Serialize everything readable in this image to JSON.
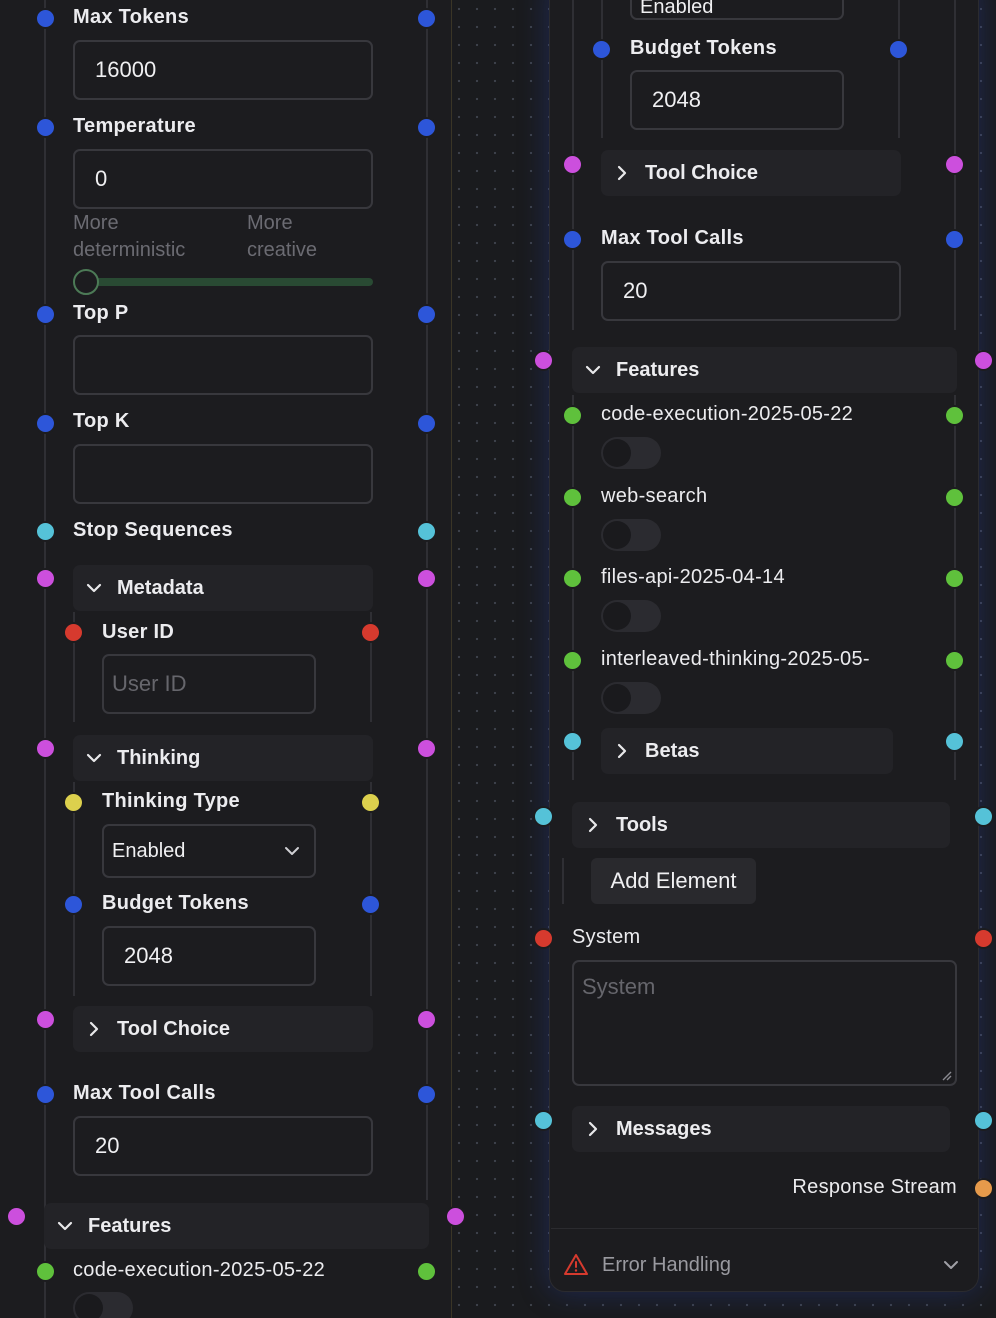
{
  "left": {
    "max_tokens": {
      "label": "Max Tokens",
      "value": "16000"
    },
    "temperature": {
      "label": "Temperature",
      "value": "0",
      "hint_low": "More deterministic",
      "hint_high": "More creative",
      "level": 0
    },
    "top_p": {
      "label": "Top P",
      "value": ""
    },
    "top_k": {
      "label": "Top K",
      "value": ""
    },
    "stop_sequences": {
      "label": "Stop Sequences"
    },
    "metadata": {
      "title": "Metadata",
      "user_id": {
        "label": "User ID",
        "placeholder": "User ID"
      }
    },
    "thinking": {
      "title": "Thinking",
      "type": {
        "label": "Thinking Type",
        "value": "Enabled"
      },
      "budget": {
        "label": "Budget Tokens",
        "value": "2048"
      }
    },
    "tool_choice": {
      "title": "Tool Choice"
    },
    "max_tool_calls": {
      "label": "Max Tool Calls",
      "value": "20"
    },
    "features": {
      "title": "Features",
      "items": [
        {
          "label": "code-execution-2025-05-22",
          "enabled": false
        }
      ]
    }
  },
  "right": {
    "thinking_type_value": "Enabled",
    "budget": {
      "label": "Budget Tokens",
      "value": "2048"
    },
    "tool_choice": {
      "title": "Tool Choice"
    },
    "max_tool_calls": {
      "label": "Max Tool Calls",
      "value": "20"
    },
    "features": {
      "title": "Features",
      "items": [
        {
          "label": "code-execution-2025-05-22",
          "enabled": false
        },
        {
          "label": "web-search",
          "enabled": false
        },
        {
          "label": "files-api-2025-04-14",
          "enabled": false
        },
        {
          "label": "interleaved-thinking-2025-05-",
          "enabled": false
        }
      ],
      "betas": "Betas"
    },
    "tools": {
      "title": "Tools",
      "add_element": "Add Element"
    },
    "system": {
      "label": "System",
      "placeholder": "System"
    },
    "messages": {
      "title": "Messages"
    },
    "response_stream": "Response Stream",
    "error_handling": "Error Handling"
  },
  "colors": {
    "blue": "#2d56d9",
    "cyan": "#55c2d8",
    "magenta": "#cc4fdd",
    "red": "#d63a2e",
    "yellow": "#dcd04d",
    "green": "#5fc13c",
    "orange": "#e69a4b"
  }
}
